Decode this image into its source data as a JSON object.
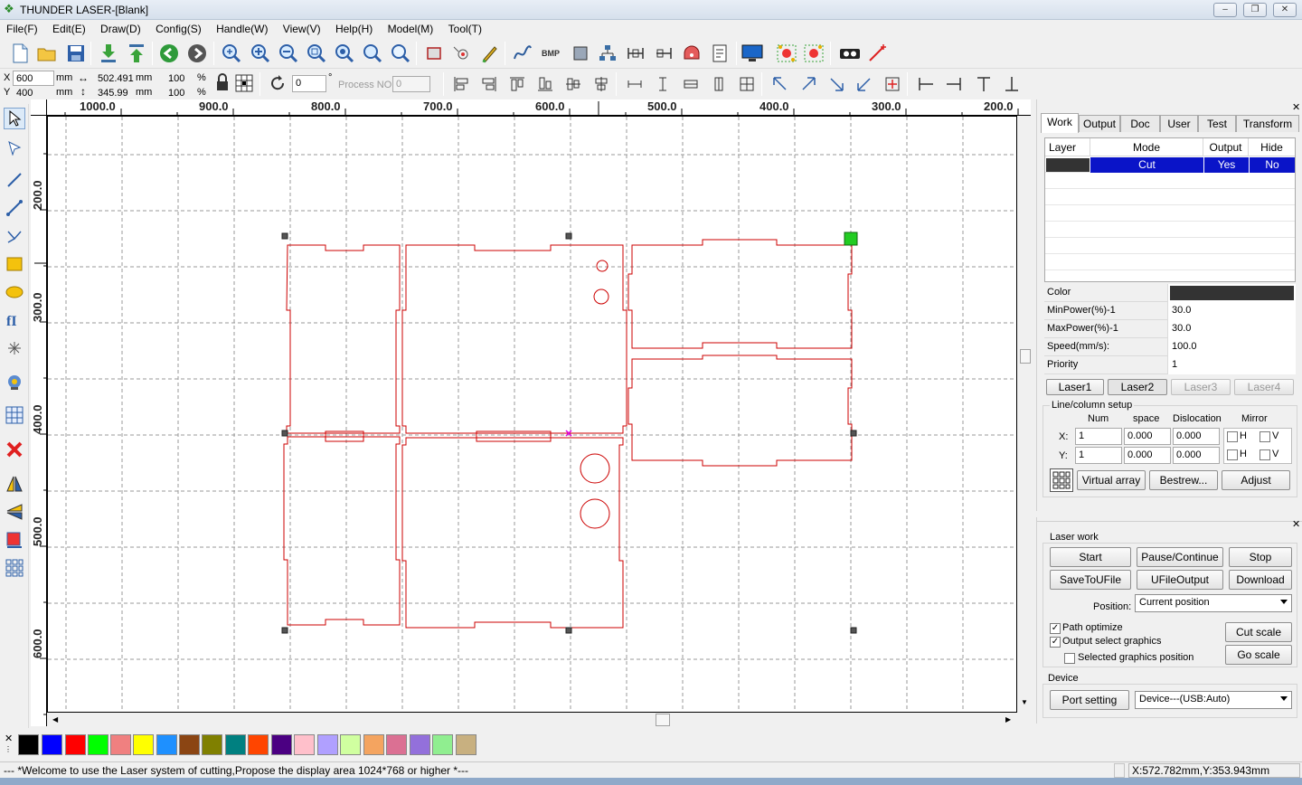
{
  "window": {
    "title": "THUNDER LASER-[Blank]"
  },
  "menu": [
    "File(F)",
    "Edit(E)",
    "Draw(D)",
    "Config(S)",
    "Handle(W)",
    "View(V)",
    "Help(H)",
    "Model(M)",
    "Tool(T)"
  ],
  "position": {
    "x_label": "X",
    "y_label": "Y",
    "x": "600",
    "y": "400",
    "unit": "mm"
  },
  "size": {
    "w": "502.491",
    "h": "345.99",
    "unit": "mm"
  },
  "scale": {
    "x": "100",
    "y": "100",
    "unit": "%"
  },
  "rotation": {
    "value": "0",
    "unit": "°"
  },
  "process": {
    "label": "Process NO:",
    "value": "0"
  },
  "ruler": {
    "h": [
      "1000.0",
      "900.0",
      "800.0",
      "700.0",
      "600.0",
      "500.0",
      "400.0",
      "300.0",
      "200.0"
    ],
    "v": [
      "200.0",
      "300.0",
      "400.0",
      "500.0",
      "600.0"
    ]
  },
  "tabs": [
    "Work",
    "Output",
    "Doc",
    "User",
    "Test",
    "Transform"
  ],
  "layers": {
    "headers": [
      "Layer",
      "Mode",
      "Output",
      "Hide"
    ],
    "rows": [
      {
        "mode": "Cut",
        "output": "Yes",
        "hide": "No",
        "color": "#333333"
      }
    ]
  },
  "props": [
    {
      "k": "Color",
      "v": ""
    },
    {
      "k": "MinPower(%)-1",
      "v": "30.0"
    },
    {
      "k": "MaxPower(%)-1",
      "v": "30.0"
    },
    {
      "k": "Speed(mm/s):",
      "v": "100.0"
    },
    {
      "k": "Priority",
      "v": "1"
    }
  ],
  "lasers": [
    "Laser1",
    "Laser2",
    "Laser3",
    "Laser4"
  ],
  "array": {
    "title": "Line/column setup",
    "headers": [
      "Num",
      "space",
      "Dislocation",
      "Mirror"
    ],
    "x_label": "X:",
    "y_label": "Y:",
    "x": {
      "num": "1",
      "space": "0.000",
      "disloc": "0.000"
    },
    "y": {
      "num": "1",
      "space": "0.000",
      "disloc": "0.000"
    },
    "h": "H",
    "v": "V"
  },
  "array_buttons": [
    "Virtual array",
    "Bestrew...",
    "Adjust"
  ],
  "laserwork": {
    "title": "Laser work",
    "buttons": [
      "Start",
      "Pause/Continue",
      "Stop",
      "SaveToUFile",
      "UFileOutput",
      "Download"
    ],
    "position_label": "Position:",
    "position_value": "Current position",
    "path_opt": "Path optimize",
    "output_sel": "Output select graphics",
    "sel_pos": "Selected graphics position",
    "cut_scale": "Cut scale",
    "go_scale": "Go scale"
  },
  "device": {
    "title": "Device",
    "port_btn": "Port setting",
    "device_value": "Device---(USB:Auto)"
  },
  "palette": [
    "#000000",
    "#0000ff",
    "#ff0000",
    "#00ff00",
    "#f08080",
    "#ffff00",
    "#1e90ff",
    "#8b4513",
    "#808000",
    "#008080",
    "#ff4500",
    "#4b0082",
    "#ffc0cb",
    "#b0a0ff",
    "#d0ffa0",
    "#f4a460",
    "#db7093",
    "#9370db",
    "#90ee90",
    "#c8b080"
  ],
  "status": {
    "message": "--- *Welcome to use the Laser system of cutting,Propose the display area 1024*768 or higher *---",
    "coords": "X:572.782mm,Y:353.943mm"
  },
  "colors": {
    "cut": "#cc0000",
    "selected": "#0a14c8",
    "handle": "#555555"
  }
}
